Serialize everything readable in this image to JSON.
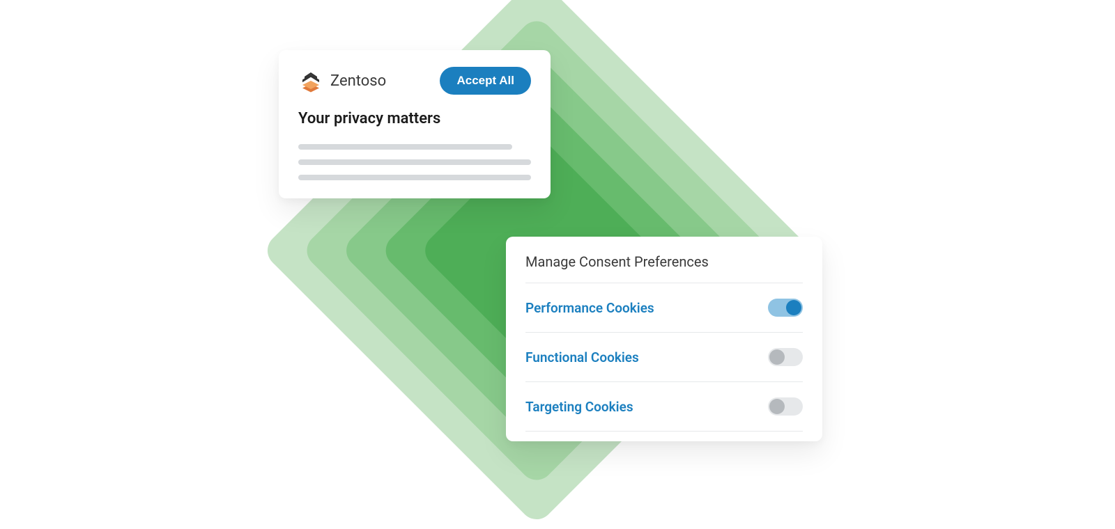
{
  "privacyCard": {
    "brand": "Zentoso",
    "acceptLabel": "Accept All",
    "headline": "Your privacy matters"
  },
  "consentCard": {
    "title": "Manage Consent Preferences",
    "rows": [
      {
        "label": "Performance Cookies",
        "on": true
      },
      {
        "label": "Functional Cookies",
        "on": false
      },
      {
        "label": "Targeting Cookies",
        "on": false
      }
    ]
  },
  "colors": {
    "accentBlue": "#1b7fbf",
    "toggleOnTrack": "#8fc3e3",
    "toggleOffTrack": "#e6e8ea",
    "toggleOffKnob": "#b5b9bd"
  }
}
